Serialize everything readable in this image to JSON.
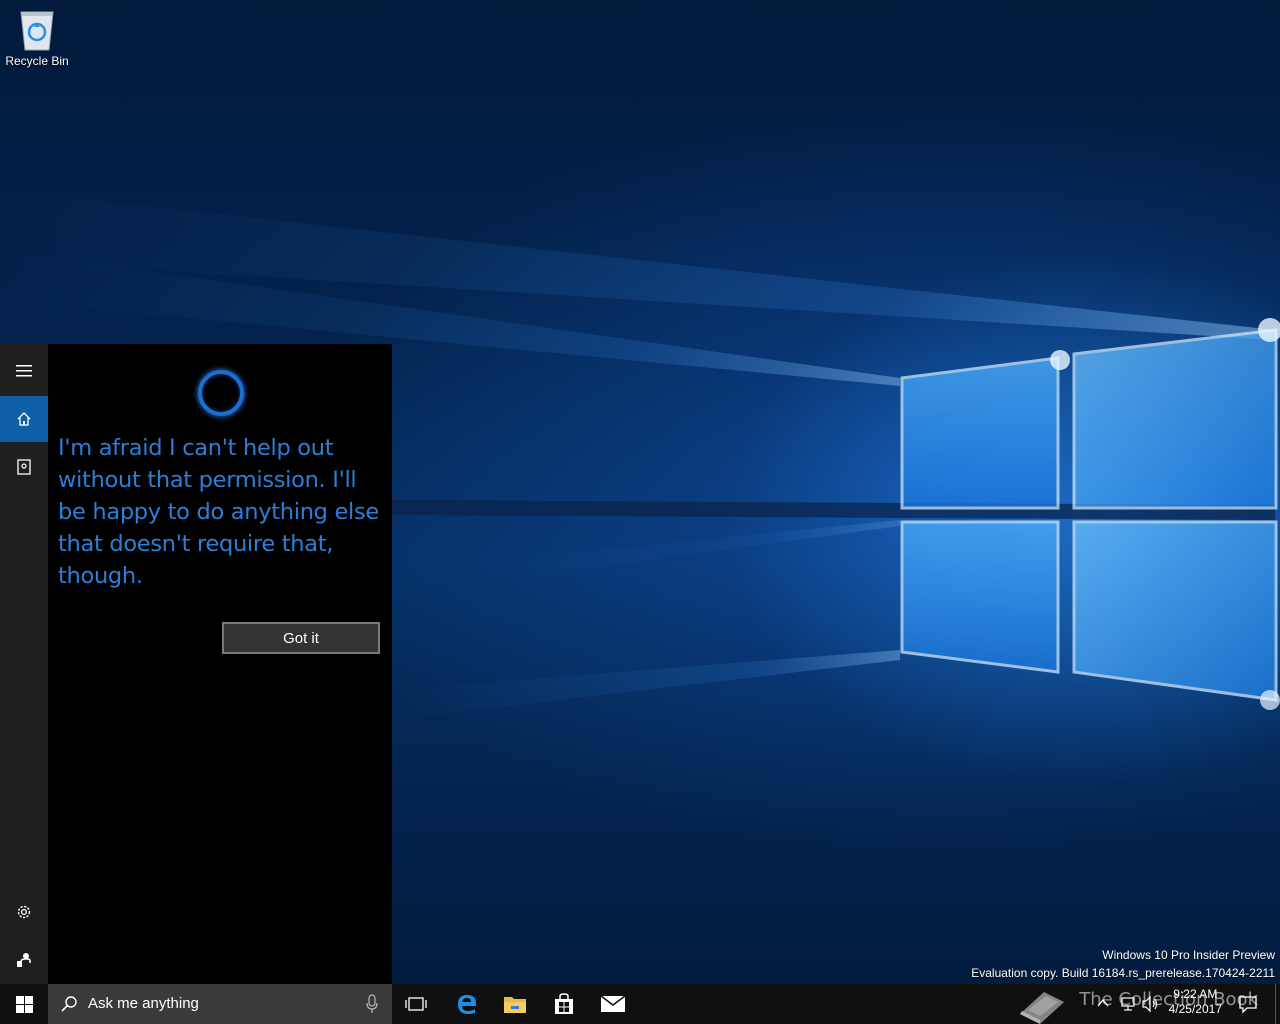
{
  "desktop": {
    "icons": [
      {
        "label": "Recycle Bin",
        "icon": "recycle-bin-icon"
      }
    ],
    "watermark": {
      "line1": "Windows 10 Pro Insider Preview",
      "line2": "Evaluation copy. Build 16184.rs_prerelease.170424-2211"
    }
  },
  "cortana": {
    "rail": {
      "items": [
        {
          "icon": "hamburger-menu-icon"
        },
        {
          "icon": "home-icon",
          "active": true
        },
        {
          "icon": "notebook-icon"
        },
        {
          "icon": "settings-gear-icon"
        },
        {
          "icon": "feedback-icon"
        }
      ]
    },
    "message": "I'm afraid I can't help out without that permission. I'll be happy to do anything else that doesn't require that, though.",
    "got_it_label": "Got it",
    "accent_color": "#2c7fd8"
  },
  "taskbar": {
    "search_placeholder": "Ask me anything",
    "pinned": [
      {
        "icon": "task-view-icon"
      },
      {
        "icon": "edge-browser-icon"
      },
      {
        "icon": "file-explorer-icon"
      },
      {
        "icon": "store-icon"
      },
      {
        "icon": "mail-icon"
      }
    ],
    "tray": {
      "icons": [
        "chevron-up-icon",
        "network-icon",
        "volume-icon"
      ],
      "time": "9:22 AM",
      "date": "4/25/2017"
    },
    "overlay_text": "The Collection Book"
  }
}
